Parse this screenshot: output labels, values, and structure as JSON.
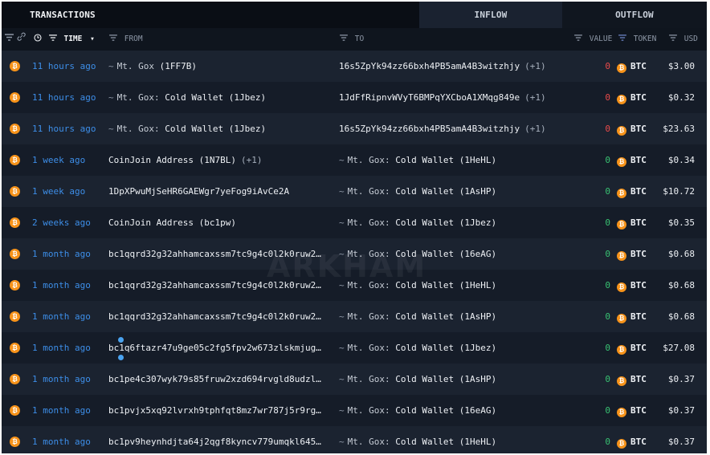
{
  "tabs": {
    "transactions": "TRANSACTIONS",
    "inflow": "INFLOW",
    "outflow": "OUTFLOW"
  },
  "columns": {
    "time": "TIME",
    "from": "FROM",
    "to": "TO",
    "value": "VALUE",
    "token": "TOKEN",
    "usd": "USD"
  },
  "watermark": "ARKHAM",
  "colors": {
    "btc": "#f7931a",
    "link": "#3d8ee8",
    "outflow": "#e84a4a",
    "inflow": "#38c172"
  },
  "rows": [
    {
      "time": "11 hours ago",
      "from": {
        "tilde": true,
        "entity": "Mt. Gox",
        "sub": "(1FF7B)"
      },
      "to": {
        "tilde": false,
        "entity": "",
        "sub": "16s5ZpYk94zz66bxh4PB5amA4B3witzhjy",
        "plus": "(+1)"
      },
      "value": "0",
      "dir": "out",
      "token": "BTC",
      "usd": "$3.00"
    },
    {
      "time": "11 hours ago",
      "from": {
        "tilde": true,
        "entity": "Mt. Gox:",
        "sub": "Cold Wallet (1Jbez)"
      },
      "to": {
        "tilde": false,
        "entity": "",
        "sub": "1JdFfRipnvWVyT6BMPqYXCboA1XMqg849e",
        "plus": "(+1)"
      },
      "value": "0",
      "dir": "out",
      "token": "BTC",
      "usd": "$0.32"
    },
    {
      "time": "11 hours ago",
      "from": {
        "tilde": true,
        "entity": "Mt. Gox:",
        "sub": "Cold Wallet (1Jbez)"
      },
      "to": {
        "tilde": false,
        "entity": "",
        "sub": "16s5ZpYk94zz66bxh4PB5amA4B3witzhjy",
        "plus": "(+1)"
      },
      "value": "0",
      "dir": "out",
      "token": "BTC",
      "usd": "$23.63"
    },
    {
      "time": "1 week ago",
      "from": {
        "tilde": false,
        "entity": "",
        "sub": "CoinJoin Address (1N7BL)",
        "plus": "(+1)"
      },
      "to": {
        "tilde": true,
        "entity": "Mt. Gox:",
        "sub": "Cold Wallet (1HeHL)"
      },
      "value": "0",
      "dir": "in",
      "token": "BTC",
      "usd": "$0.34"
    },
    {
      "time": "1 week ago",
      "from": {
        "tilde": false,
        "entity": "",
        "sub": "1DpXPwuMjSeHR6GAEWgr7yeFog9iAvCe2A"
      },
      "to": {
        "tilde": true,
        "entity": "Mt. Gox:",
        "sub": "Cold Wallet (1AsHP)"
      },
      "value": "0",
      "dir": "in",
      "token": "BTC",
      "usd": "$10.72"
    },
    {
      "time": "2 weeks ago",
      "from": {
        "tilde": false,
        "entity": "",
        "sub": "CoinJoin Address (bc1pw)"
      },
      "to": {
        "tilde": true,
        "entity": "Mt. Gox:",
        "sub": "Cold Wallet (1Jbez)"
      },
      "value": "0",
      "dir": "in",
      "token": "BTC",
      "usd": "$0.35"
    },
    {
      "time": "1 month ago",
      "from": {
        "tilde": false,
        "entity": "",
        "sub": "bc1qqrd32g32ahhamcaxssm7tc9g4c0l2k0ruw2…"
      },
      "to": {
        "tilde": true,
        "entity": "Mt. Gox:",
        "sub": "Cold Wallet (16eAG)"
      },
      "value": "0",
      "dir": "in",
      "token": "BTC",
      "usd": "$0.68"
    },
    {
      "time": "1 month ago",
      "from": {
        "tilde": false,
        "entity": "",
        "sub": "bc1qqrd32g32ahhamcaxssm7tc9g4c0l2k0ruw2…"
      },
      "to": {
        "tilde": true,
        "entity": "Mt. Gox:",
        "sub": "Cold Wallet (1HeHL)"
      },
      "value": "0",
      "dir": "in",
      "token": "BTC",
      "usd": "$0.68"
    },
    {
      "time": "1 month ago",
      "from": {
        "tilde": false,
        "entity": "",
        "sub": "bc1qqrd32g32ahhamcaxssm7tc9g4c0l2k0ruw2…"
      },
      "to": {
        "tilde": true,
        "entity": "Mt. Gox:",
        "sub": "Cold Wallet (1AsHP)"
      },
      "value": "0",
      "dir": "in",
      "token": "BTC",
      "usd": "$0.68"
    },
    {
      "time": "1 month ago",
      "from": {
        "tilde": false,
        "entity": "",
        "sub": "bc1q6ftazr47u9ge05c2fg5fpv2w673zlskmjug…"
      },
      "to": {
        "tilde": true,
        "entity": "Mt. Gox:",
        "sub": "Cold Wallet (1Jbez)"
      },
      "value": "0",
      "dir": "in",
      "token": "BTC",
      "usd": "$27.08"
    },
    {
      "time": "1 month ago",
      "from": {
        "tilde": false,
        "entity": "",
        "sub": "bc1pe4c307wyk79s85fruw2xzd694rvgld8udzl…"
      },
      "to": {
        "tilde": true,
        "entity": "Mt. Gox:",
        "sub": "Cold Wallet (1AsHP)"
      },
      "value": "0",
      "dir": "in",
      "token": "BTC",
      "usd": "$0.37"
    },
    {
      "time": "1 month ago",
      "from": {
        "tilde": false,
        "entity": "",
        "sub": "bc1pvjx5xq92lvrxh9tphfqt8mz7wr787j5r9rg…"
      },
      "to": {
        "tilde": true,
        "entity": "Mt. Gox:",
        "sub": "Cold Wallet (16eAG)"
      },
      "value": "0",
      "dir": "in",
      "token": "BTC",
      "usd": "$0.37"
    },
    {
      "time": "1 month ago",
      "from": {
        "tilde": false,
        "entity": "",
        "sub": "bc1pv9heynhdjta64j2qgf8kyncv779umqkl645…"
      },
      "to": {
        "tilde": true,
        "entity": "Mt. Gox:",
        "sub": "Cold Wallet (1HeHL)"
      },
      "value": "0",
      "dir": "in",
      "token": "BTC",
      "usd": "$0.37"
    }
  ]
}
